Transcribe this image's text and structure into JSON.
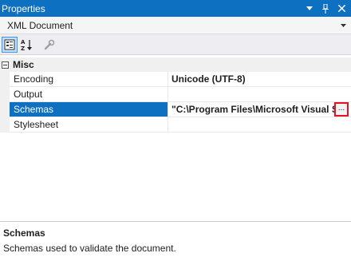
{
  "window": {
    "title": "Properties"
  },
  "object_selector": {
    "value": "XML Document"
  },
  "grid": {
    "category": "Misc",
    "rows": [
      {
        "name": "Encoding",
        "value": "Unicode (UTF-8)"
      },
      {
        "name": "Output",
        "value": ""
      },
      {
        "name": "Schemas",
        "value": "\"C:\\Program Files\\Microsoft Visual Stu",
        "selected": true
      },
      {
        "name": "Stylesheet",
        "value": ""
      }
    ],
    "ellipsis_label": "..."
  },
  "description": {
    "title": "Schemas",
    "text": "Schemas used to validate the document."
  },
  "colors": {
    "title_bg": "#0e70c0",
    "selected_bg": "#0e70c0",
    "highlight_border": "#e81123"
  }
}
